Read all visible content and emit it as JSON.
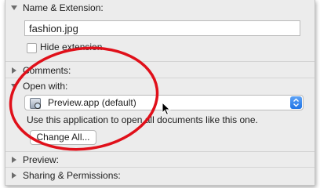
{
  "name_section": {
    "header": "Name & Extension:",
    "filename": "fashion.jpg",
    "hide_extension_label": "Hide extension",
    "hide_extension_checked": false
  },
  "comments": {
    "header": "Comments:"
  },
  "open_with": {
    "header": "Open with:",
    "app": "Preview.app (default)",
    "description": "Use this application to open all documents like this one.",
    "change_all_label": "Change All..."
  },
  "preview": {
    "header": "Preview:"
  },
  "sharing": {
    "header": "Sharing & Permissions:"
  },
  "colors": {
    "annotation": "#e0101a",
    "stepper": "#2f80ed"
  },
  "icons": [
    "disclosure-triangle-icon",
    "preview-app-icon",
    "popup-stepper-icon",
    "mouse-pointer-icon"
  ]
}
